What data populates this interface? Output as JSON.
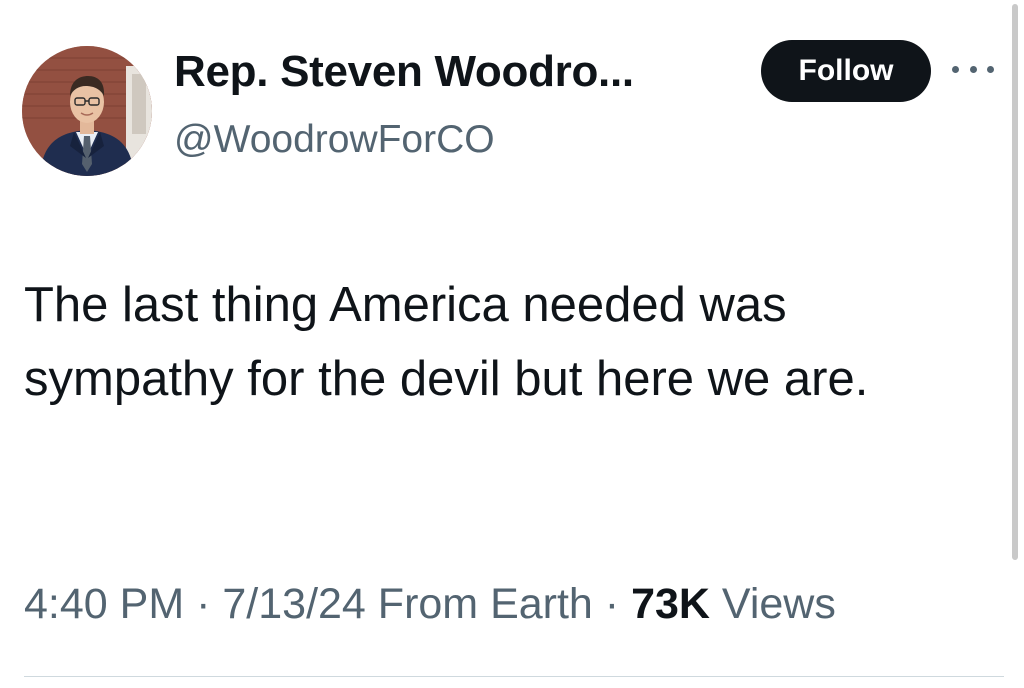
{
  "author": {
    "display_name": "Rep. Steven Woodro...",
    "handle": "@WoodrowForCO",
    "avatar": "profile-photo"
  },
  "follow_label": "Follow",
  "more_icon": "more-horizontal-icon",
  "tweet": {
    "text": "The last thing America needed was sympathy for the devil but here we are."
  },
  "meta": {
    "time": "4:40 PM",
    "separator": "·",
    "date": "7/13/24",
    "source": "From Earth",
    "views_count": "73K",
    "views_label": "Views"
  },
  "colors": {
    "text_primary": "#0f1419",
    "text_secondary": "#536471",
    "button_bg": "#0f1419",
    "button_text": "#ffffff"
  }
}
